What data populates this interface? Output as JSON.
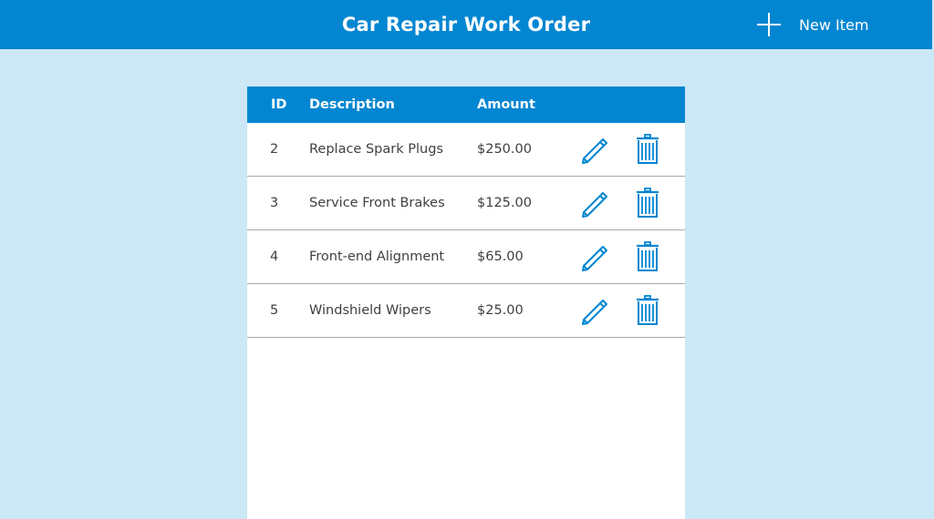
{
  "header": {
    "title": "Car Repair Work Order",
    "new_item_label": "New Item"
  },
  "table": {
    "columns": {
      "id": "ID",
      "description": "Description",
      "amount": "Amount"
    },
    "rows": [
      {
        "id": "2",
        "description": "Replace Spark Plugs",
        "amount": "$250.00"
      },
      {
        "id": "3",
        "description": "Service Front Brakes",
        "amount": "$125.00"
      },
      {
        "id": "4",
        "description": "Front-end Alignment",
        "amount": "$65.00"
      },
      {
        "id": "5",
        "description": "Windshield Wipers",
        "amount": "$25.00"
      }
    ]
  },
  "icons": {
    "add": "plus-icon",
    "edit": "pencil-icon",
    "delete": "trash-icon"
  },
  "colors": {
    "accent": "#0286d1",
    "background": "#cce7f6",
    "panel": "#ffffff",
    "row_text": "#3f3f3f",
    "row_divider": "#a9a9a9"
  }
}
